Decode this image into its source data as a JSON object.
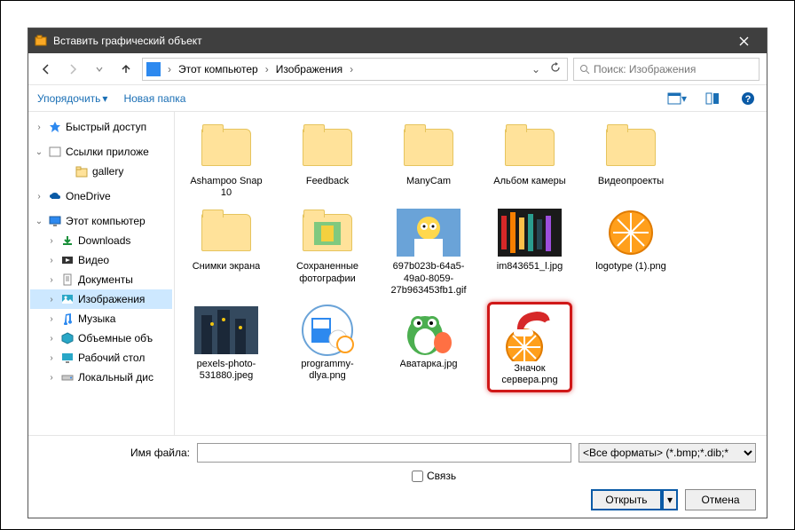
{
  "window": {
    "title": "Вставить графический объект"
  },
  "path": {
    "root": "Этот компьютер",
    "folder": "Изображения"
  },
  "search": {
    "placeholder": "Поиск: Изображения"
  },
  "toolbar": {
    "organize": "Упорядочить",
    "newfolder": "Новая папка"
  },
  "tree": {
    "quick": "Быстрый доступ",
    "links": "Ссылки приложе",
    "gallery": "gallery",
    "onedrive": "OneDrive",
    "thispc": "Этот компьютер",
    "downloads": "Downloads",
    "videos": "Видео",
    "documents": "Документы",
    "pictures": "Изображения",
    "music": "Музыка",
    "volumes": "Объемные объ",
    "desktop": "Рабочий стол",
    "localdisk": "Локальный дис"
  },
  "items": [
    {
      "name": "Ashampoo Snap 10",
      "type": "folder"
    },
    {
      "name": "Feedback",
      "type": "folder"
    },
    {
      "name": "ManyCam",
      "type": "folder"
    },
    {
      "name": "Альбом камеры",
      "type": "folder"
    },
    {
      "name": "Видеопроекты",
      "type": "folder"
    },
    {
      "name": "Снимки экрана",
      "type": "folder"
    },
    {
      "name": "Сохраненные фотографии",
      "type": "folder-thumb"
    },
    {
      "name": "697b023b-64a5-49a0-8059-27b963453fb1.gif",
      "type": "img-homer"
    },
    {
      "name": "im843651_l.jpg",
      "type": "img-lights"
    },
    {
      "name": "logotype (1).png",
      "type": "img-orange"
    },
    {
      "name": "pexels-photo-531880.jpeg",
      "type": "img-city"
    },
    {
      "name": "programmy-dlya.png",
      "type": "img-prog"
    },
    {
      "name": "Аватарка.jpg",
      "type": "img-yoshi"
    },
    {
      "name": "Значок сервера.png",
      "type": "img-santa",
      "highlight": true
    }
  ],
  "bottom": {
    "filename_label": "Имя файла:",
    "filename_value": "",
    "filter": "<Все форматы> (*.bmp;*.dib;*",
    "link_checkbox": "Связь",
    "open": "Открыть",
    "cancel": "Отмена"
  }
}
